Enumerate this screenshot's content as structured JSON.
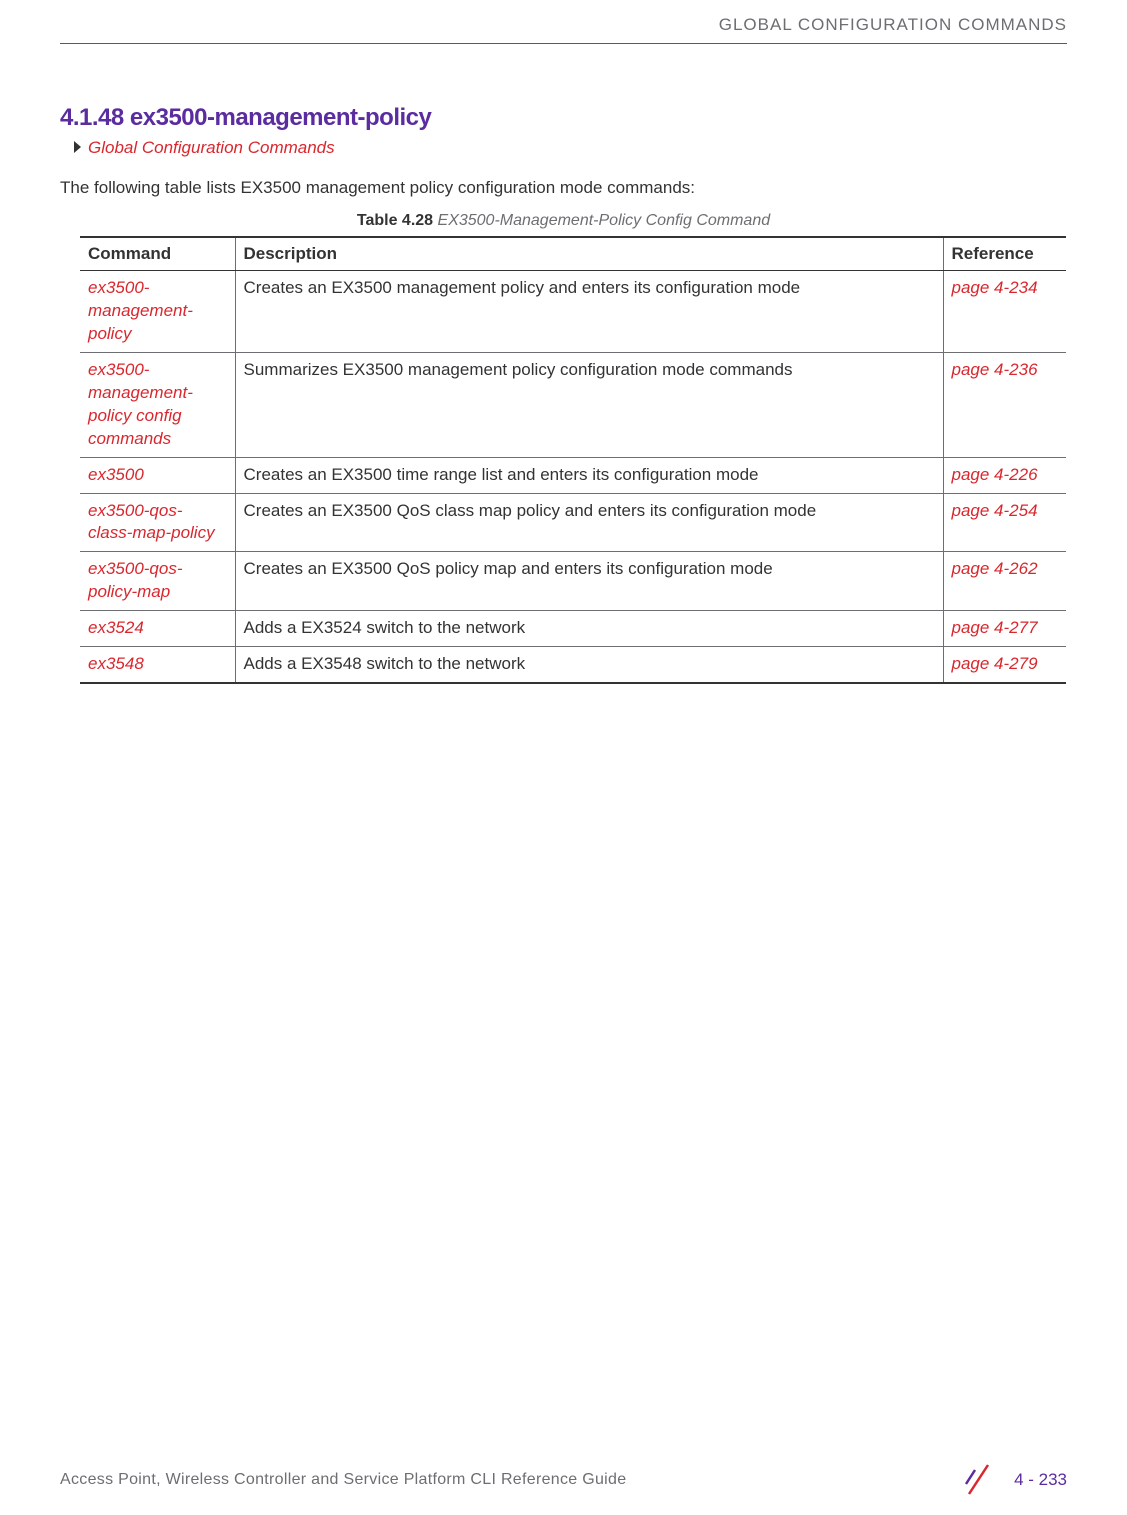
{
  "header": {
    "category": "GLOBAL CONFIGURATION COMMANDS"
  },
  "section": {
    "number_title": "4.1.48 ex3500-management-policy",
    "breadcrumb": "Global Configuration Commands",
    "intro": "The following table lists EX3500 management policy configuration mode commands:"
  },
  "table": {
    "caption_bold": "Table 4.28",
    "caption_italic": "EX3500-Management-Policy Config Command",
    "headers": {
      "command": "Command",
      "description": "Description",
      "reference": "Reference"
    },
    "rows": [
      {
        "command": "ex3500-management-policy",
        "description": "Creates an EX3500 management policy and enters its configuration mode",
        "reference": "page 4-234"
      },
      {
        "command": "ex3500-management-policy config commands",
        "description": "Summarizes EX3500 management policy configuration mode commands",
        "reference": "page 4-236"
      },
      {
        "command": "ex3500",
        "description": "Creates an EX3500 time range list and enters its configuration mode",
        "reference": "page 4-226"
      },
      {
        "command": "ex3500-qos-class-map-policy",
        "description": "Creates an EX3500 QoS class map policy and enters its configuration mode",
        "reference": "page 4-254"
      },
      {
        "command": "ex3500-qos-policy-map",
        "description": "Creates an EX3500 QoS policy map and enters its configuration mode",
        "reference": "page 4-262"
      },
      {
        "command": "ex3524",
        "description": "Adds a EX3524 switch to the network",
        "reference": "page 4-277"
      },
      {
        "command": "ex3548",
        "description": "Adds a EX3548 switch to the network",
        "reference": "page 4-279"
      }
    ]
  },
  "footer": {
    "guide_name": "Access Point, Wireless Controller and Service Platform CLI Reference Guide",
    "page_number": "4 - 233"
  }
}
